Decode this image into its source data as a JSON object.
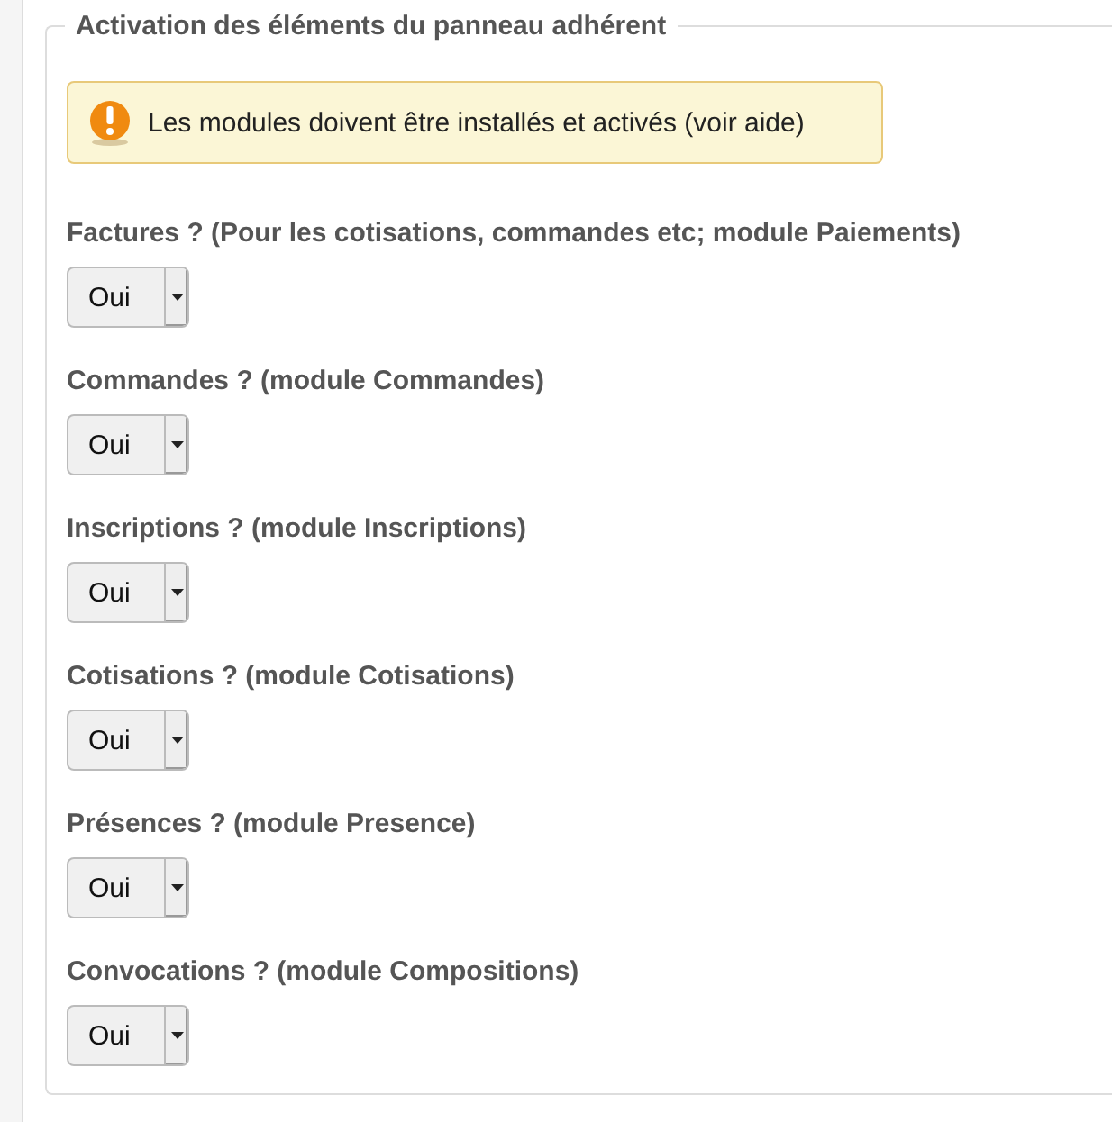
{
  "legend": "Activation des éléments du panneau adhérent",
  "alert": {
    "text": "Les modules doivent être installés et activés (voir aide)"
  },
  "fields": [
    {
      "label": "Factures ? (Pour les cotisations, commandes etc; module Paiements)",
      "value": "Oui"
    },
    {
      "label": "Commandes ? (module Commandes)",
      "value": "Oui"
    },
    {
      "label": "Inscriptions ? (module Inscriptions)",
      "value": "Oui"
    },
    {
      "label": "Cotisations ? (module Cotisations)",
      "value": "Oui"
    },
    {
      "label": "Présences ? (module Presence)",
      "value": "Oui"
    },
    {
      "label": "Convocations ? (module Compositions)",
      "value": "Oui"
    }
  ]
}
